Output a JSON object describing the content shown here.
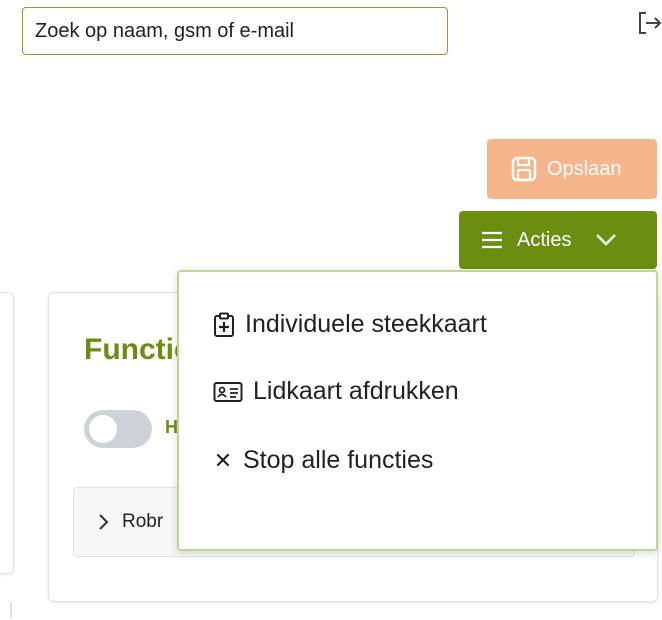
{
  "search": {
    "placeholder": "Zoek op naam, gsm of e-mail"
  },
  "toolbar": {
    "save_label": "Opslaan",
    "actions_label": "Acties"
  },
  "card": {
    "title": "Functies",
    "toggle_label": "H",
    "row_label": "Robr"
  },
  "actions_menu": {
    "items": [
      {
        "label": "Individuele steekkaart",
        "icon": "clipboard-plus-icon"
      },
      {
        "label": "Lidkaart afdrukken",
        "icon": "id-card-icon"
      },
      {
        "label": "Stop alle functies",
        "icon": "x-icon"
      }
    ]
  },
  "colors": {
    "accent": "#6b8e11",
    "save_button": "#f6b58a",
    "dropdown_border": "#bfd98a",
    "toggle_off": "#cfd3d7"
  }
}
